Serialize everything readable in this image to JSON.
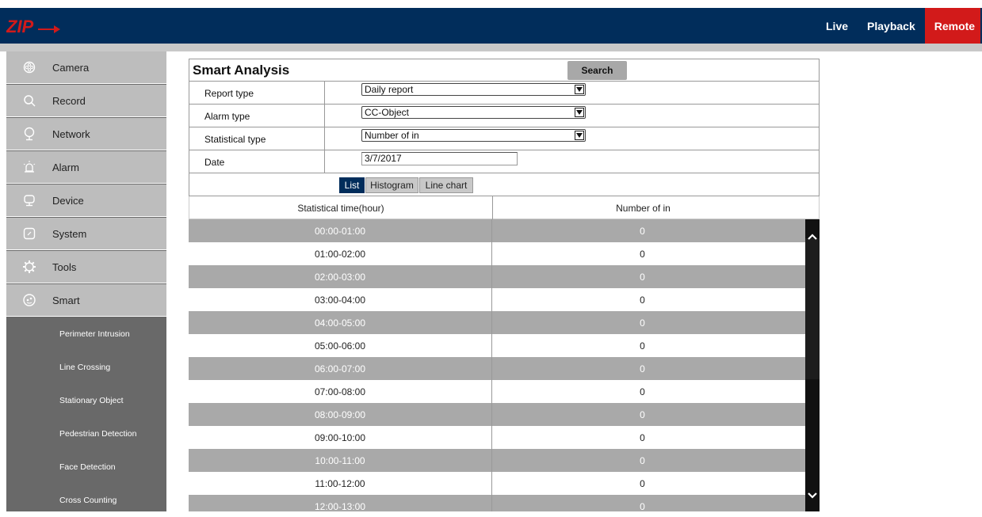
{
  "header": {
    "logo_text": "ZIP",
    "nav": [
      {
        "label": "Live"
      },
      {
        "label": "Playback"
      },
      {
        "label": "Remote"
      }
    ]
  },
  "sidebar": {
    "items": [
      {
        "label": "Camera",
        "icon": "camera-icon"
      },
      {
        "label": "Record",
        "icon": "search-icon"
      },
      {
        "label": "Network",
        "icon": "network-icon"
      },
      {
        "label": "Alarm",
        "icon": "alarm-icon"
      },
      {
        "label": "Device",
        "icon": "device-icon"
      },
      {
        "label": "System",
        "icon": "system-icon"
      },
      {
        "label": "Tools",
        "icon": "gear-icon"
      },
      {
        "label": "Smart",
        "icon": "smart-icon"
      }
    ],
    "sub_items": [
      {
        "label": "Perimeter Intrusion"
      },
      {
        "label": "Line Crossing"
      },
      {
        "label": "Stationary Object"
      },
      {
        "label": "Pedestrian Detection"
      },
      {
        "label": "Face Detection"
      },
      {
        "label": "Cross Counting"
      }
    ]
  },
  "main": {
    "title": "Smart Analysis",
    "search_label": "Search",
    "fields": [
      {
        "label": "Report type",
        "value": "Daily report"
      },
      {
        "label": "Alarm type",
        "value": "CC-Object"
      },
      {
        "label": "Statistical type",
        "value": "Number of in"
      }
    ],
    "date": {
      "label": "Date",
      "value": "3/7/2017"
    },
    "tabs": [
      {
        "label": "List"
      },
      {
        "label": "Histogram"
      },
      {
        "label": "Line chart"
      }
    ],
    "table": {
      "headers": [
        "Statistical time(hour)",
        "Number of in"
      ],
      "rows": [
        [
          "00:00-01:00",
          "0"
        ],
        [
          "01:00-02:00",
          "0"
        ],
        [
          "02:00-03:00",
          "0"
        ],
        [
          "03:00-04:00",
          "0"
        ],
        [
          "04:00-05:00",
          "0"
        ],
        [
          "05:00-06:00",
          "0"
        ],
        [
          "06:00-07:00",
          "0"
        ],
        [
          "07:00-08:00",
          "0"
        ],
        [
          "08:00-09:00",
          "0"
        ],
        [
          "09:00-10:00",
          "0"
        ],
        [
          "10:00-11:00",
          "0"
        ],
        [
          "11:00-12:00",
          "0"
        ],
        [
          "12:00-13:00",
          "0"
        ]
      ]
    }
  },
  "colors": {
    "header_bg": "#012d5b",
    "remote_bg": "#d21a1a",
    "sidebar_item_bg": "#bdbdbd",
    "submenu_bg": "#696969",
    "row_alt_bg": "#a9a9a9"
  }
}
